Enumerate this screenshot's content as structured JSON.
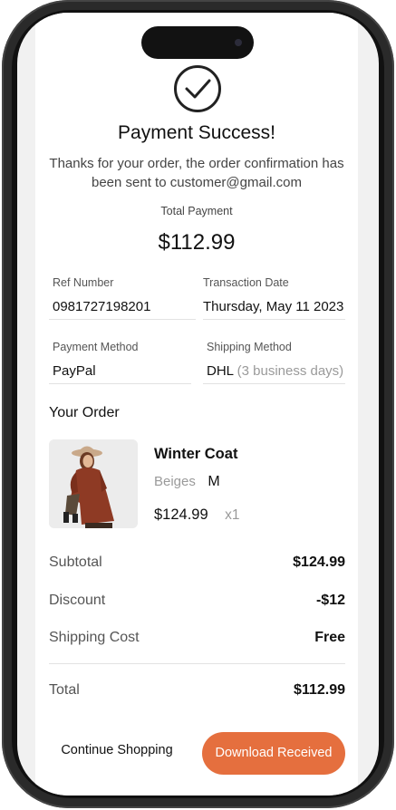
{
  "header": {
    "title": "Payment Success!",
    "message": "Thanks for your order, the order confirmation has been sent to customer@gmail.com",
    "total_payment_label": "Total Payment",
    "total_payment_amount": "$112.99"
  },
  "details": {
    "ref_number": {
      "label": "Ref Number",
      "value": "0981727198201"
    },
    "transaction_date": {
      "label": "Transaction Date",
      "value": "Thursday, May 11 2023"
    },
    "payment_method": {
      "label": "Payment Method",
      "value": "PayPal"
    },
    "shipping_method": {
      "label": "Shipping Method",
      "value": "DHL",
      "note": "(3 business days)"
    }
  },
  "order": {
    "section_title": "Your Order",
    "item": {
      "name": "Winter Coat",
      "color": "Beiges",
      "size": "M",
      "price": "$124.99",
      "quantity": "x1"
    }
  },
  "summary": {
    "subtotal": {
      "label": "Subtotal",
      "value": "$124.99"
    },
    "discount": {
      "label": "Discount",
      "value": "-$12"
    },
    "shipping": {
      "label": "Shipping Cost",
      "value": "Free"
    },
    "total": {
      "label": "Total",
      "value": "$112.99"
    }
  },
  "actions": {
    "continue_label": "Continue Shopping",
    "download_label": "Download Received"
  },
  "icons": {
    "success": "check-circle-icon"
  },
  "colors": {
    "accent": "#e56f3e",
    "muted": "#9a9a9a"
  }
}
